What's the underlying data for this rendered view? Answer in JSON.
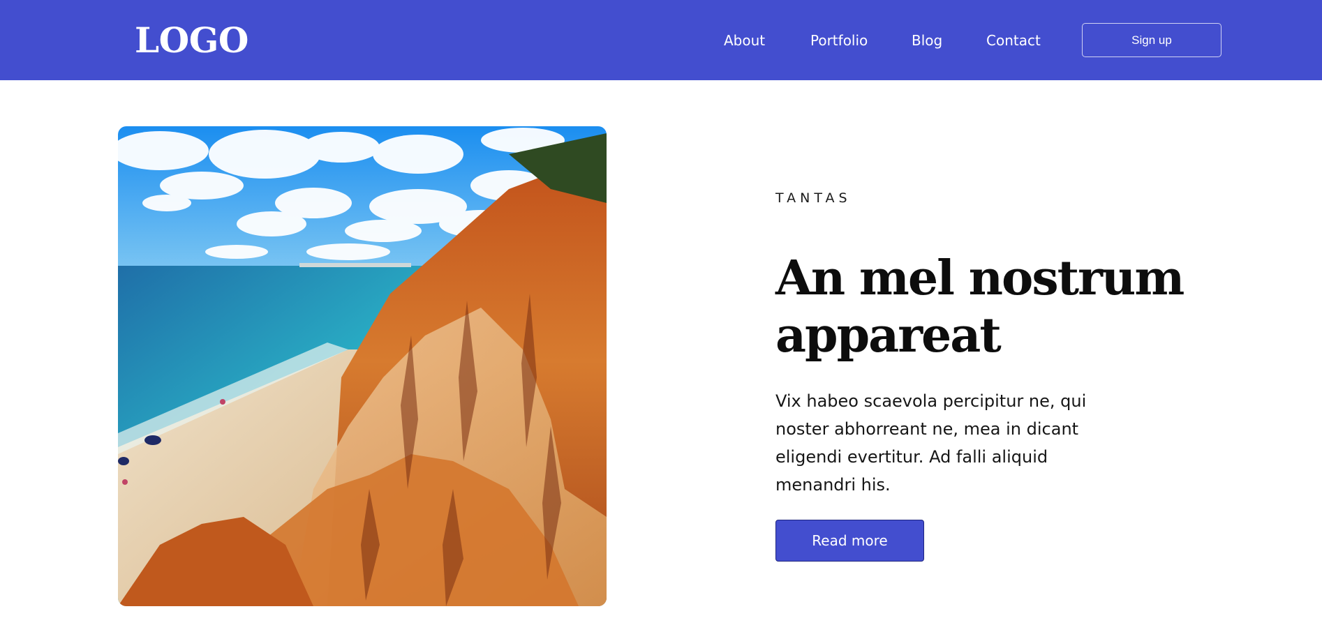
{
  "header": {
    "logo": "LOGO",
    "nav": [
      {
        "label": "About"
      },
      {
        "label": "Portfolio"
      },
      {
        "label": "Blog"
      },
      {
        "label": "Contact"
      }
    ],
    "signup_label": "Sign up"
  },
  "hero": {
    "eyebrow": "TANTAS",
    "headline": "An mel nostrum appareat",
    "body": "Vix habeo scaevola percipitur ne, qui noster abhorreant ne, mea in dicant eligendi evertitur. Ad falli aliquid menandri his.",
    "button_label": "Read more"
  },
  "colors": {
    "brand": "#434ecf",
    "text": "#0d0d0d",
    "background": "#ffffff"
  }
}
